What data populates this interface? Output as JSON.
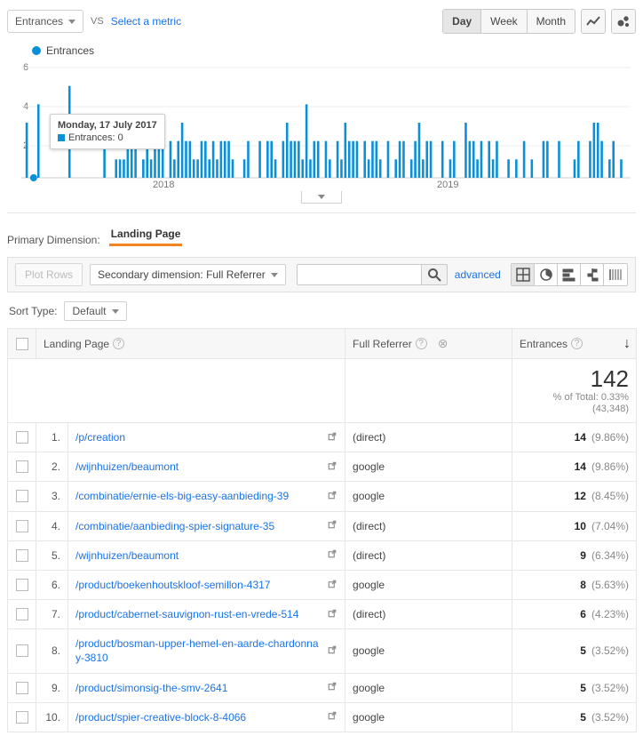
{
  "top": {
    "metric": "Entrances",
    "vs": "VS",
    "select_metric": "Select a metric",
    "granularity": {
      "day": "Day",
      "week": "Week",
      "month": "Month",
      "active": "Day"
    }
  },
  "legend": {
    "label": "Entrances"
  },
  "tooltip": {
    "title": "Monday, 17 July 2017",
    "series": "Entrances:",
    "value": "0"
  },
  "axis": {
    "y6": "6",
    "y4": "4",
    "y2": "2",
    "x2018": "2018",
    "x2019": "2019"
  },
  "dimension": {
    "label": "Primary Dimension:",
    "tab": "Landing Page"
  },
  "toolbar": {
    "plot_rows": "Plot Rows",
    "secondary_dim": "Secondary dimension: Full Referrer",
    "advanced": "advanced"
  },
  "sort": {
    "label": "Sort Type:",
    "value": "Default"
  },
  "table": {
    "headers": {
      "landing_page": "Landing Page",
      "full_referrer": "Full Referrer",
      "entrances": "Entrances"
    },
    "total": {
      "value": "142",
      "sub1": "% of Total: 0.33%",
      "sub2": "(43,348)"
    },
    "rows": [
      {
        "idx": "1.",
        "lp": "/p/creation",
        "ref": "(direct)",
        "ent": "14",
        "pct": "(9.86%)"
      },
      {
        "idx": "2.",
        "lp": "/wijnhuizen/beaumont",
        "ref": "google",
        "ent": "14",
        "pct": "(9.86%)"
      },
      {
        "idx": "3.",
        "lp": "/combinatie/ernie-els-big-easy-aanbieding-39",
        "ref": "google",
        "ent": "12",
        "pct": "(8.45%)"
      },
      {
        "idx": "4.",
        "lp": "/combinatie/aanbieding-spier-signature-35",
        "ref": "(direct)",
        "ent": "10",
        "pct": "(7.04%)"
      },
      {
        "idx": "5.",
        "lp": "/wijnhuizen/beaumont",
        "ref": "(direct)",
        "ent": "9",
        "pct": "(6.34%)"
      },
      {
        "idx": "6.",
        "lp": "/product/boekenhoutskloof-semillon-4317",
        "ref": "google",
        "ent": "8",
        "pct": "(5.63%)"
      },
      {
        "idx": "7.",
        "lp": "/product/cabernet-sauvignon-rust-en-vrede-514",
        "ref": "(direct)",
        "ent": "6",
        "pct": "(4.23%)"
      },
      {
        "idx": "8.",
        "lp": "/product/bosman-upper-hemel-en-aarde-chardonnay-3810",
        "ref": "google",
        "ent": "5",
        "pct": "(3.52%)"
      },
      {
        "idx": "9.",
        "lp": "/product/simonsig-the-smv-2641",
        "ref": "google",
        "ent": "5",
        "pct": "(3.52%)"
      },
      {
        "idx": "10.",
        "lp": "/product/spier-creative-block-8-4066",
        "ref": "google",
        "ent": "5",
        "pct": "(3.52%)"
      }
    ]
  },
  "chart_data": {
    "type": "bar",
    "title": "Entrances",
    "xlabel": "",
    "ylabel": "",
    "ylim": [
      0,
      6
    ],
    "x_ticks": [
      "2018",
      "2019"
    ],
    "y_ticks": [
      2,
      4,
      6
    ],
    "categories_note": "dense daily series mid-2017 to late-2019; estimated values from pixel height",
    "values": [
      3,
      0,
      0,
      4,
      0,
      0,
      0,
      0,
      0,
      0,
      0,
      5,
      0,
      0,
      0,
      0,
      0,
      0,
      0,
      0,
      2,
      0,
      0,
      1,
      1,
      1,
      2,
      2,
      2,
      0,
      1,
      3,
      1,
      2,
      2,
      2,
      0,
      2,
      1,
      2,
      3,
      2,
      2,
      1,
      1,
      2,
      2,
      1,
      2,
      1,
      2,
      2,
      2,
      1,
      0,
      0,
      1,
      2,
      0,
      0,
      2,
      0,
      2,
      2,
      1,
      0,
      2,
      3,
      2,
      2,
      2,
      1,
      4,
      1,
      2,
      2,
      0,
      2,
      1,
      0,
      2,
      1,
      3,
      2,
      2,
      2,
      0,
      2,
      1,
      2,
      2,
      1,
      0,
      2,
      0,
      1,
      2,
      2,
      0,
      1,
      2,
      3,
      1,
      2,
      2,
      0,
      0,
      2,
      0,
      1,
      2,
      0,
      0,
      3,
      2,
      2,
      1,
      2,
      0,
      2,
      1,
      2,
      0,
      0,
      1,
      0,
      1,
      0,
      2,
      0,
      1,
      0,
      0,
      2,
      2,
      0,
      0,
      2,
      0,
      0,
      0,
      1,
      2,
      0,
      0,
      2,
      3,
      3,
      2,
      0,
      1,
      2,
      0,
      1,
      0
    ]
  }
}
